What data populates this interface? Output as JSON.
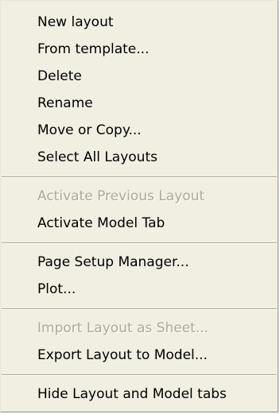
{
  "menu": {
    "groups": [
      {
        "items": [
          {
            "label": "New layout",
            "enabled": true
          },
          {
            "label": "From template...",
            "enabled": true
          },
          {
            "label": "Delete",
            "enabled": true
          },
          {
            "label": "Rename",
            "enabled": true
          },
          {
            "label": "Move or Copy...",
            "enabled": true
          },
          {
            "label": "Select All Layouts",
            "enabled": true
          }
        ]
      },
      {
        "items": [
          {
            "label": "Activate Previous Layout",
            "enabled": false
          },
          {
            "label": "Activate Model Tab",
            "enabled": true
          }
        ]
      },
      {
        "items": [
          {
            "label": "Page Setup Manager...",
            "enabled": true
          },
          {
            "label": "Plot...",
            "enabled": true
          }
        ]
      },
      {
        "items": [
          {
            "label": "Import Layout as Sheet...",
            "enabled": false
          },
          {
            "label": "Export Layout to Model...",
            "enabled": true
          }
        ]
      },
      {
        "items": [
          {
            "label": "Hide Layout and Model tabs",
            "enabled": true
          }
        ]
      }
    ],
    "colors": {
      "background": "#f1efe2",
      "text": "#000000",
      "disabled_text": "#aca899"
    }
  }
}
